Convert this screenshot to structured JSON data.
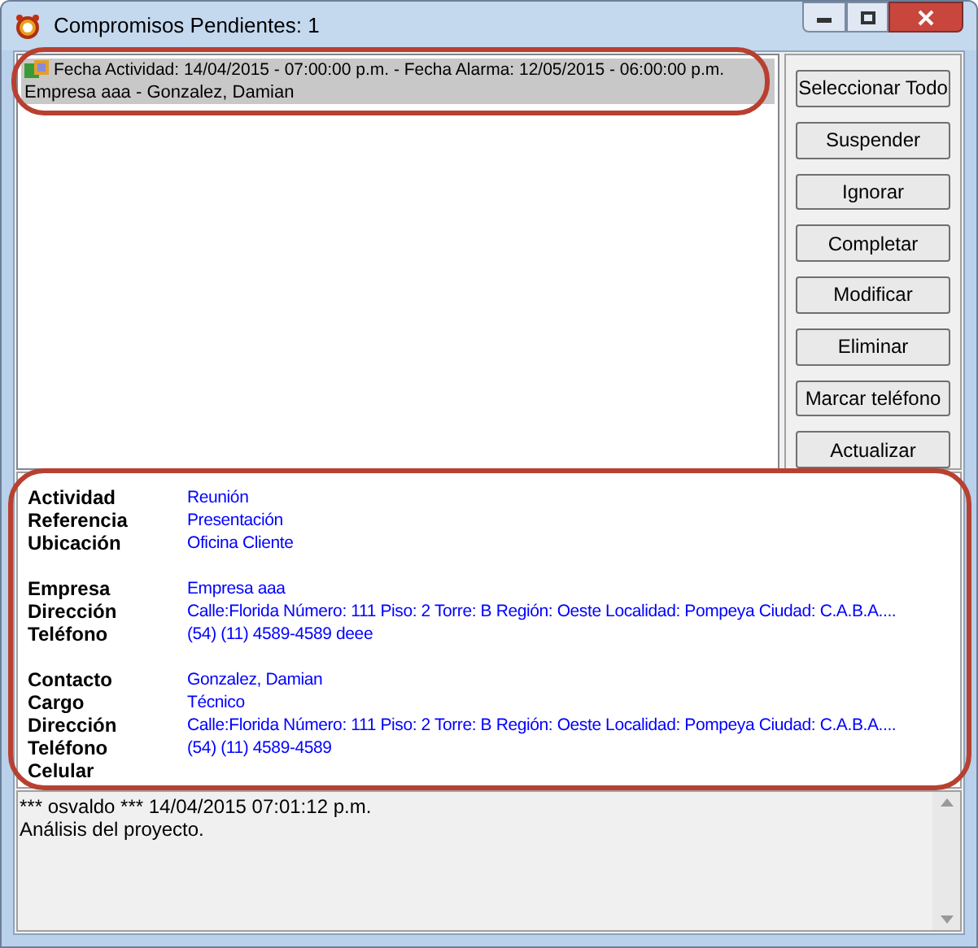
{
  "window": {
    "title": "Compromisos Pendientes: 1"
  },
  "list": [
    {
      "line1": "Fecha Actividad: 14/04/2015 - 07:00:00 p.m. - Fecha Alarma: 12/05/2015 - 06:00:00 p.m.",
      "line2": "Empresa aaa - Gonzalez, Damian",
      "selected": true
    }
  ],
  "buttons": [
    "Seleccionar Todo",
    "Suspender",
    "Ignorar",
    "Completar",
    "Modificar",
    "Eliminar",
    "Marcar teléfono",
    "Actualizar"
  ],
  "details": [
    [
      {
        "label": "Actividad",
        "value": "Reunión"
      },
      {
        "label": "Referencia",
        "value": "Presentación"
      },
      {
        "label": "Ubicación",
        "value": "Oficina Cliente"
      }
    ],
    [
      {
        "label": "Empresa",
        "value": "Empresa aaa"
      },
      {
        "label": "Dirección",
        "value": "Calle:Florida Número: 111 Piso: 2 Torre: B Región: Oeste Localidad: Pompeya Ciudad: C.A.B.A...."
      },
      {
        "label": "Teléfono",
        "value": "(54) (11) 4589-4589 deee"
      }
    ],
    [
      {
        "label": "Contacto",
        "value": "Gonzalez, Damian"
      },
      {
        "label": "Cargo",
        "value": "Técnico"
      },
      {
        "label": "Dirección",
        "value": "Calle:Florida Número: 111 Piso: 2 Torre: B Región: Oeste Localidad: Pompeya Ciudad: C.A.B.A...."
      },
      {
        "label": "Teléfono",
        "value": "(54) (11) 4589-4589"
      },
      {
        "label": "Celular"
      }
    ]
  ],
  "notes": [
    "*** osvaldo *** 14/04/2015 07:01:12 p.m.",
    "Análisis del proyecto."
  ]
}
